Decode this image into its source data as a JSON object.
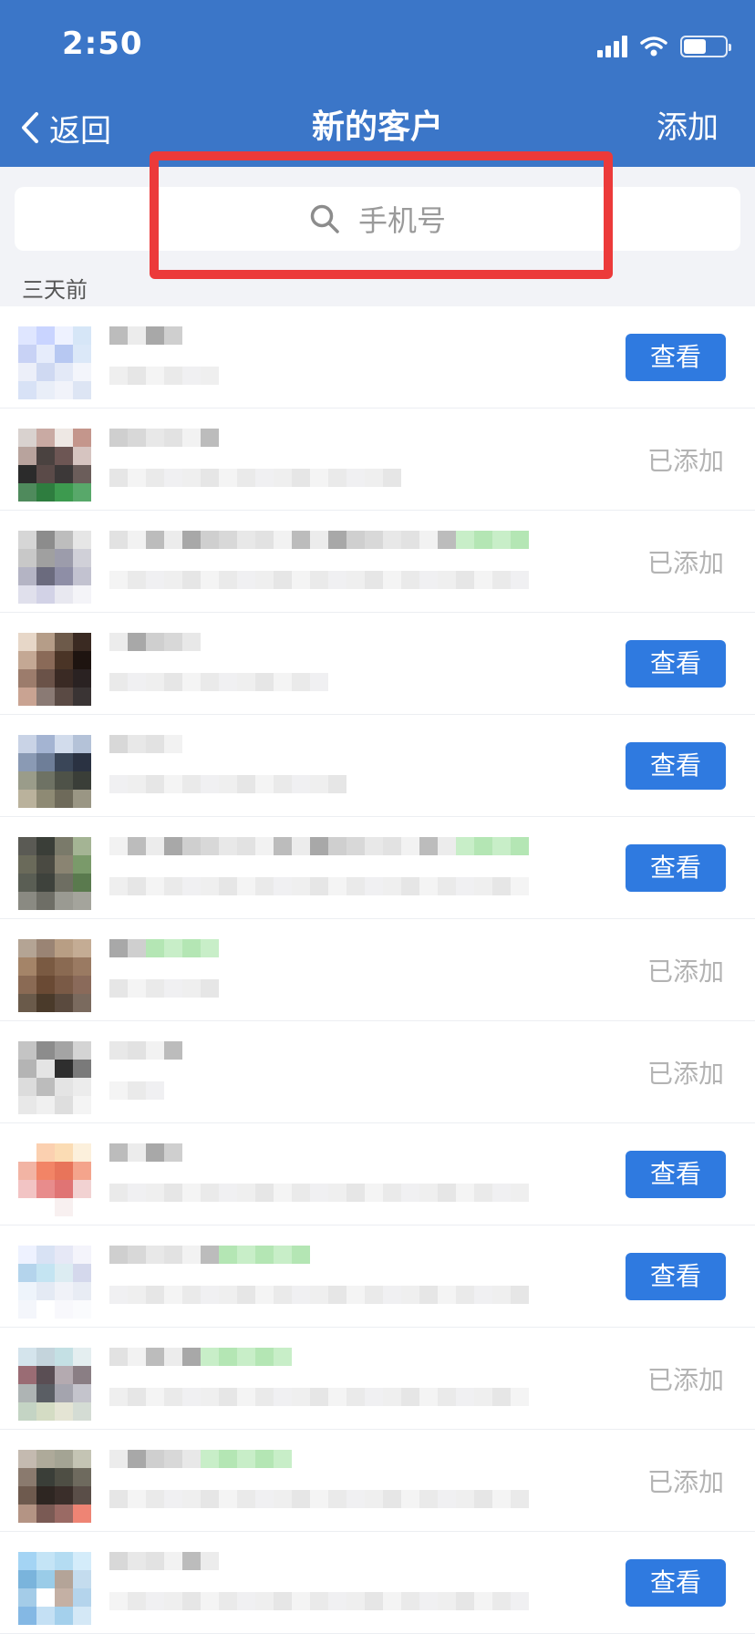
{
  "status_bar": {
    "time": "2:50"
  },
  "nav": {
    "back_label": "返回",
    "title": "新的客户",
    "add_label": "添加"
  },
  "search": {
    "placeholder": "手机号"
  },
  "section": {
    "label": "三天前"
  },
  "rows": [
    {
      "status": "view",
      "action_label": "查看"
    },
    {
      "status": "added",
      "action_label": "已添加"
    },
    {
      "status": "added",
      "action_label": "已添加"
    },
    {
      "status": "view",
      "action_label": "查看"
    },
    {
      "status": "view",
      "action_label": "查看"
    },
    {
      "status": "view",
      "action_label": "查看"
    },
    {
      "status": "added",
      "action_label": "已添加"
    },
    {
      "status": "added",
      "action_label": "已添加"
    },
    {
      "status": "view",
      "action_label": "查看"
    },
    {
      "status": "view",
      "action_label": "查看"
    },
    {
      "status": "added",
      "action_label": "已添加"
    },
    {
      "status": "added",
      "action_label": "已添加"
    },
    {
      "status": "view",
      "action_label": "查看"
    }
  ],
  "colors": {
    "nav_bg": "#3b76c8",
    "button_bg": "#2f7ae0",
    "added_text": "#b3b3b3",
    "highlight": "#ec3a3a"
  },
  "icons": {
    "back": "chevron-left-icon",
    "search": "search-icon",
    "signal": "signal-icon",
    "wifi": "wifi-icon",
    "battery": "battery-icon"
  }
}
